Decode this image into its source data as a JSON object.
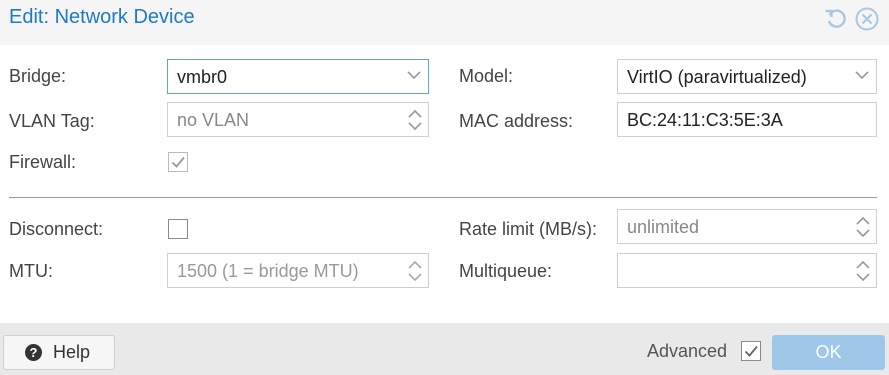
{
  "dialog": {
    "title": "Edit: Network Device",
    "icons": {
      "reset": "reset-icon",
      "close": "close-icon"
    }
  },
  "form": {
    "bridge": {
      "label": "Bridge:",
      "value": "vmbr0"
    },
    "vlan_tag": {
      "label": "VLAN Tag:",
      "placeholder": "no VLAN"
    },
    "firewall": {
      "label": "Firewall:",
      "checked": true
    },
    "model": {
      "label": "Model:",
      "value": "VirtIO (paravirtualized)"
    },
    "mac_address": {
      "label": "MAC address:",
      "value": "BC:24:11:C3:5E:3A"
    },
    "disconnect": {
      "label": "Disconnect:",
      "checked": false
    },
    "mtu": {
      "label": "MTU:",
      "placeholder": "1500 (1 = bridge MTU)"
    },
    "rate_limit": {
      "label": "Rate limit (MB/s):",
      "placeholder": "unlimited"
    },
    "multiqueue": {
      "label": "Multiqueue:",
      "value": ""
    }
  },
  "footer": {
    "help_label": "Help",
    "advanced_label": "Advanced",
    "advanced_checked": true,
    "ok_label": "OK"
  },
  "colors": {
    "accent": "#1e7ac6",
    "ok_button": "#9fc7ea",
    "focus_border": "#5fa2dd"
  }
}
